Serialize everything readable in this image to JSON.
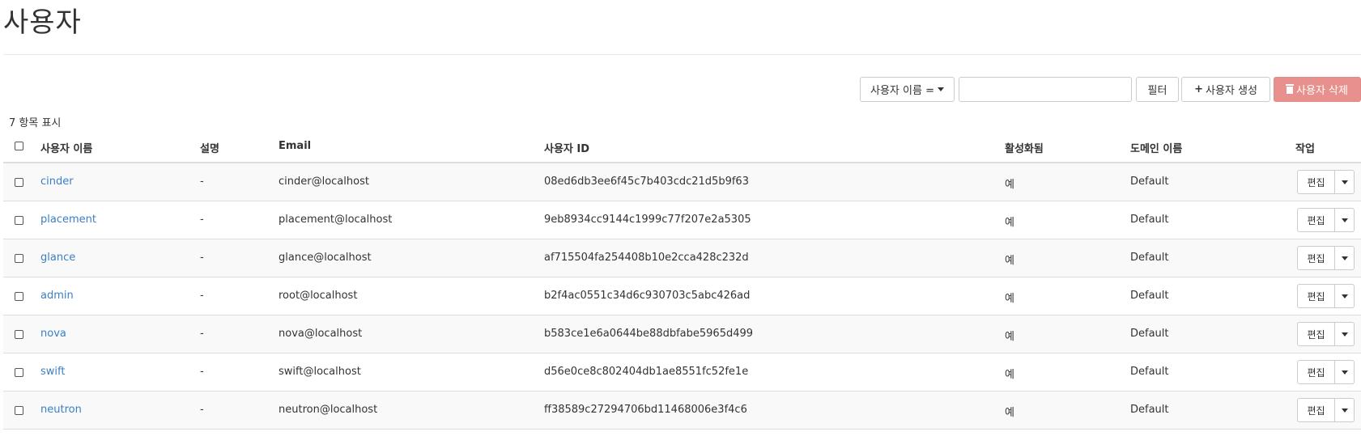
{
  "page": {
    "title": "사용자"
  },
  "toolbar": {
    "filter_field": "사용자 이름 =",
    "filter_input_value": "",
    "filter_button": "필터",
    "create_button": "사용자 생성",
    "delete_button": "사용자 삭제"
  },
  "table": {
    "count_text": "7 항목 표시",
    "headers": {
      "name": "사용자 이름",
      "description": "설명",
      "email": "Email",
      "user_id": "사용자 ID",
      "enabled": "활성화됨",
      "domain": "도메인 이름",
      "actions": "작업"
    },
    "rows": [
      {
        "name": "cinder",
        "description": "-",
        "email": "cinder@localhost",
        "user_id": "08ed6db3ee6f45c7b403cdc21d5b9f63",
        "enabled": "예",
        "domain": "Default",
        "action": "편집"
      },
      {
        "name": "placement",
        "description": "-",
        "email": "placement@localhost",
        "user_id": "9eb8934cc9144c1999c77f207e2a5305",
        "enabled": "예",
        "domain": "Default",
        "action": "편집"
      },
      {
        "name": "glance",
        "description": "-",
        "email": "glance@localhost",
        "user_id": "af715504fa254408b10e2cca428c232d",
        "enabled": "예",
        "domain": "Default",
        "action": "편집"
      },
      {
        "name": "admin",
        "description": "-",
        "email": "root@localhost",
        "user_id": "b2f4ac0551c34d6c930703c5abc426ad",
        "enabled": "예",
        "domain": "Default",
        "action": "편집"
      },
      {
        "name": "nova",
        "description": "-",
        "email": "nova@localhost",
        "user_id": "b583ce1e6a0644be88dbfabe5965d499",
        "enabled": "예",
        "domain": "Default",
        "action": "편집"
      },
      {
        "name": "swift",
        "description": "-",
        "email": "swift@localhost",
        "user_id": "d56e0ce8c802404db1ae8551fc52fe1e",
        "enabled": "예",
        "domain": "Default",
        "action": "편집"
      },
      {
        "name": "neutron",
        "description": "-",
        "email": "neutron@localhost",
        "user_id": "ff38589c27294706bd11468006e3f4c6",
        "enabled": "예",
        "domain": "Default",
        "action": "편집"
      }
    ]
  },
  "colors": {
    "link": "#3b7fc4",
    "danger_button": "#e8908d",
    "row_stripe": "#f9f9f9",
    "border": "#dddddd"
  }
}
